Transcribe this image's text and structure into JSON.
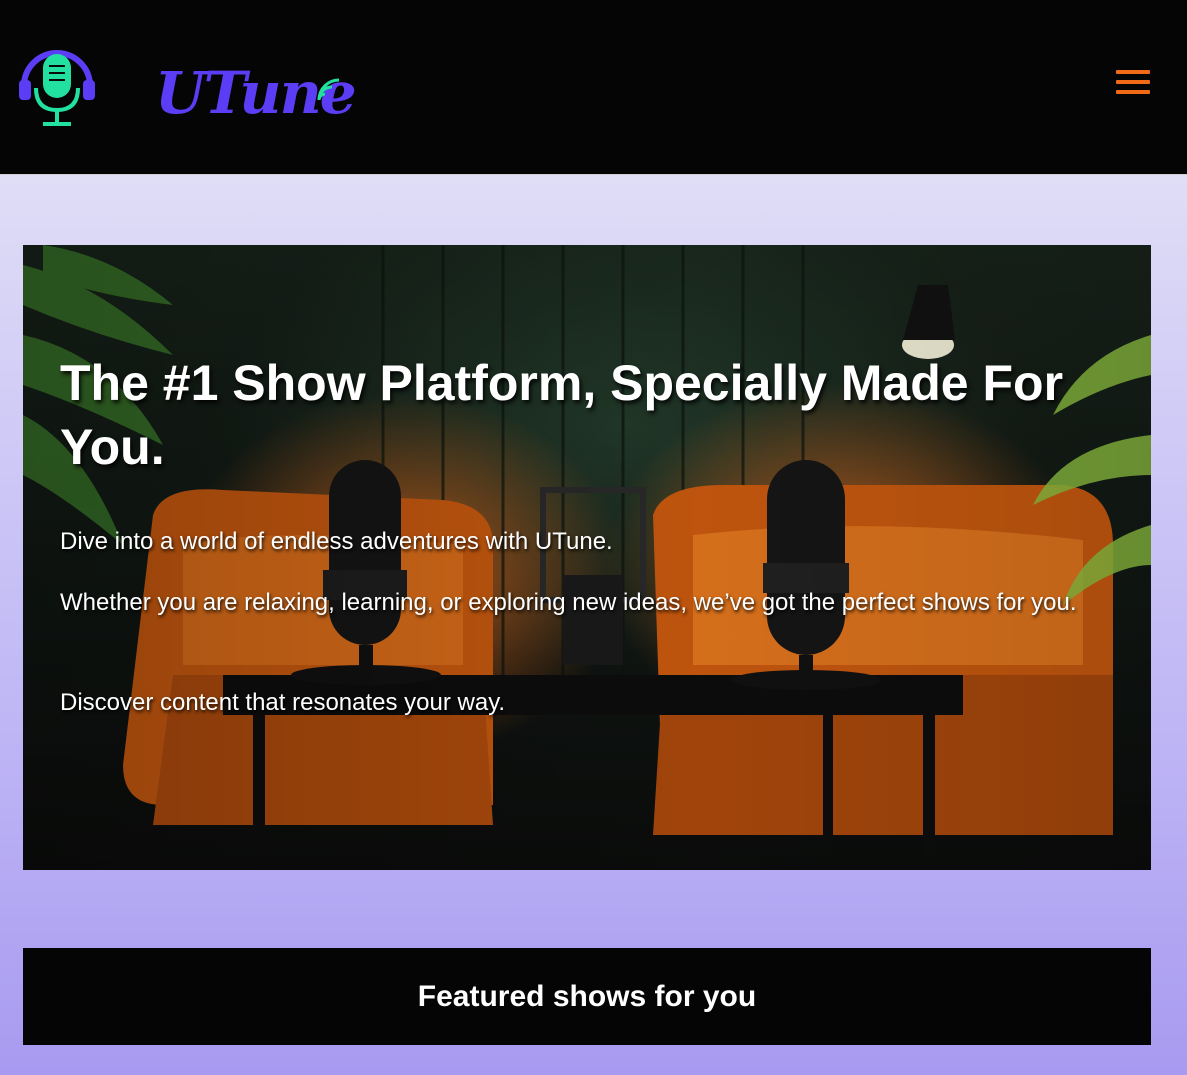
{
  "header": {
    "brand": "UTune",
    "logo_icon": "headphone-microphone-icon",
    "menu_icon": "hamburger-menu-icon",
    "colors": {
      "background": "#050505",
      "brand": "#5b3df5",
      "logo": "#22e0a0",
      "menu": "#f06a18"
    }
  },
  "hero": {
    "title": "The #1 Show Platform, Specially Made For You.",
    "paragraphs": [
      "Dive into a world of endless adventures with UTune.",
      "Whether you are relaxing, learning, or exploring new ideas, we’ve got the perfect shows for you.",
      "Discover content that resonates your way."
    ]
  },
  "featured": {
    "title": "Featured shows for you"
  }
}
